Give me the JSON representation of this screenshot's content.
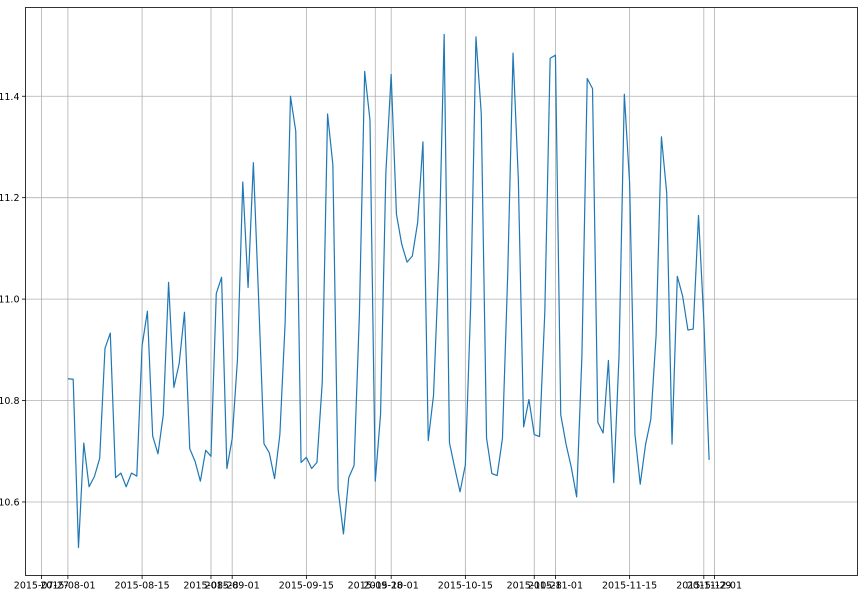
{
  "chart_data": {
    "type": "line",
    "title": "",
    "xlabel": "",
    "ylabel": "",
    "grid": true,
    "series_color": "#1f77b4",
    "xlim": [
      "2015-07-24",
      "2015-12-28"
    ],
    "ylim": [
      10.455,
      11.575
    ],
    "xticks": [
      {
        "date": "2015-07-27",
        "label": "2015-07-27"
      },
      {
        "date": "2015-08-01",
        "label": "2015-08-01"
      },
      {
        "date": "2015-08-15",
        "label": "2015-08-15"
      },
      {
        "date": "2015-08-28",
        "label": "2015-08-28"
      },
      {
        "date": "2015-09-01",
        "label": "2015-09-01"
      },
      {
        "date": "2015-09-15",
        "label": "2015-09-15"
      },
      {
        "date": "2015-09-28",
        "label": "2015-09-28"
      },
      {
        "date": "2015-10-01",
        "label": "2015-10-01"
      },
      {
        "date": "2015-10-15",
        "label": "2015-10-15"
      },
      {
        "date": "2015-10-28",
        "label": "2015-10-28"
      },
      {
        "date": "2015-11-01",
        "label": "2015-11-01"
      },
      {
        "date": "2015-11-15",
        "label": "2015-11-15"
      },
      {
        "date": "2015-11-29",
        "label": "2015-11-29"
      },
      {
        "date": "2015-12-01",
        "label": "2015-12-01"
      }
    ],
    "yticks": [
      {
        "value": 10.6,
        "label": "10.6"
      },
      {
        "value": 10.8,
        "label": "10.8"
      },
      {
        "value": 11.0,
        "label": "11.0"
      },
      {
        "value": 11.2,
        "label": "11.2"
      },
      {
        "value": 11.4,
        "label": "11.4"
      }
    ],
    "series": [
      {
        "x_start": "2015-08-01",
        "x_step_days": 1,
        "values": [
          10.843,
          10.842,
          10.51,
          10.716,
          10.63,
          10.65,
          10.686,
          10.903,
          10.933,
          10.648,
          10.657,
          10.63,
          10.657,
          10.651,
          10.908,
          10.976,
          10.73,
          10.695,
          10.772,
          11.033,
          10.826,
          10.873,
          10.974,
          10.705,
          10.68,
          10.641,
          10.702,
          10.69,
          11.011,
          11.043,
          10.666,
          10.725,
          10.881,
          11.231,
          11.023,
          11.269,
          10.998,
          10.715,
          10.697,
          10.646,
          10.733,
          10.955,
          11.4,
          11.331,
          10.678,
          10.688,
          10.666,
          10.678,
          10.836,
          11.365,
          11.265,
          10.624,
          10.537,
          10.648,
          10.672,
          10.967,
          11.449,
          11.353,
          10.641,
          10.773,
          11.249,
          11.443,
          11.167,
          11.108,
          11.073,
          11.085,
          11.151,
          11.31,
          10.721,
          10.811,
          11.073,
          11.522,
          10.717,
          10.667,
          10.62,
          10.673,
          10.985,
          11.517,
          11.366,
          10.726,
          10.656,
          10.652,
          10.725,
          11.05,
          11.485,
          11.236,
          10.748,
          10.802,
          10.733,
          10.729,
          10.976,
          11.475,
          11.481,
          10.772,
          10.714,
          10.668,
          10.61,
          10.889,
          11.435,
          11.415,
          10.757,
          10.736,
          10.879,
          10.638,
          10.889,
          11.404,
          11.228,
          10.734,
          10.635,
          10.713,
          10.763,
          10.929,
          11.32,
          11.209,
          10.714,
          11.045,
          11.006,
          10.939,
          10.941,
          11.165,
          10.958,
          10.683
        ]
      }
    ]
  }
}
